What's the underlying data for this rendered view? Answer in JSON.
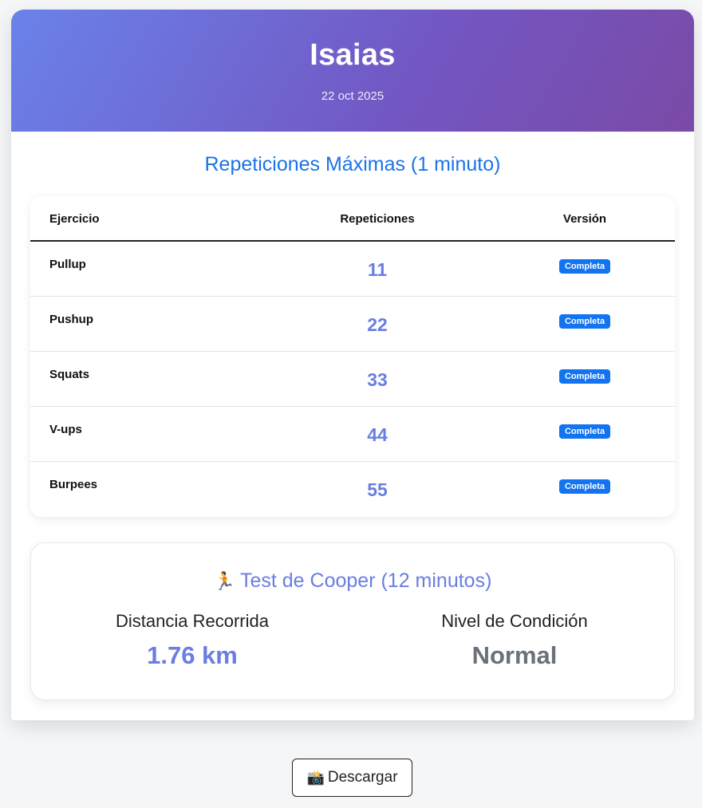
{
  "header": {
    "name": "Isaias",
    "date": "22 oct 2025",
    "gradient_start": "#6a82ea",
    "gradient_end": "#7a4aa6"
  },
  "reps": {
    "title": "Repeticiones Máximas (1 minuto)",
    "columns": [
      "Ejercicio",
      "Repeticiones",
      "Versión"
    ],
    "rows": [
      {
        "exercise": "Pullup",
        "reps": "11",
        "version": "Completa"
      },
      {
        "exercise": "Pushup",
        "reps": "22",
        "version": "Completa"
      },
      {
        "exercise": "Squats",
        "reps": "33",
        "version": "Completa"
      },
      {
        "exercise": "V-ups",
        "reps": "44",
        "version": "Completa"
      },
      {
        "exercise": "Burpees",
        "reps": "55",
        "version": "Completa"
      }
    ]
  },
  "cooper": {
    "icon": "runner-icon",
    "icon_glyph": "🏃",
    "title": "Test de Cooper (12 minutos)",
    "distance_label": "Distancia Recorrida",
    "distance_value": "1.76 km",
    "level_label": "Nivel de Condición",
    "level_value": "Normal"
  },
  "download": {
    "icon": "camera-icon",
    "icon_glyph": "📸",
    "label": "Descargar"
  },
  "colors": {
    "accent_blue": "#1a73e8",
    "value_purple": "#6a7ee0",
    "badge_blue": "#1274f0",
    "level_gray": "#6b7178"
  }
}
